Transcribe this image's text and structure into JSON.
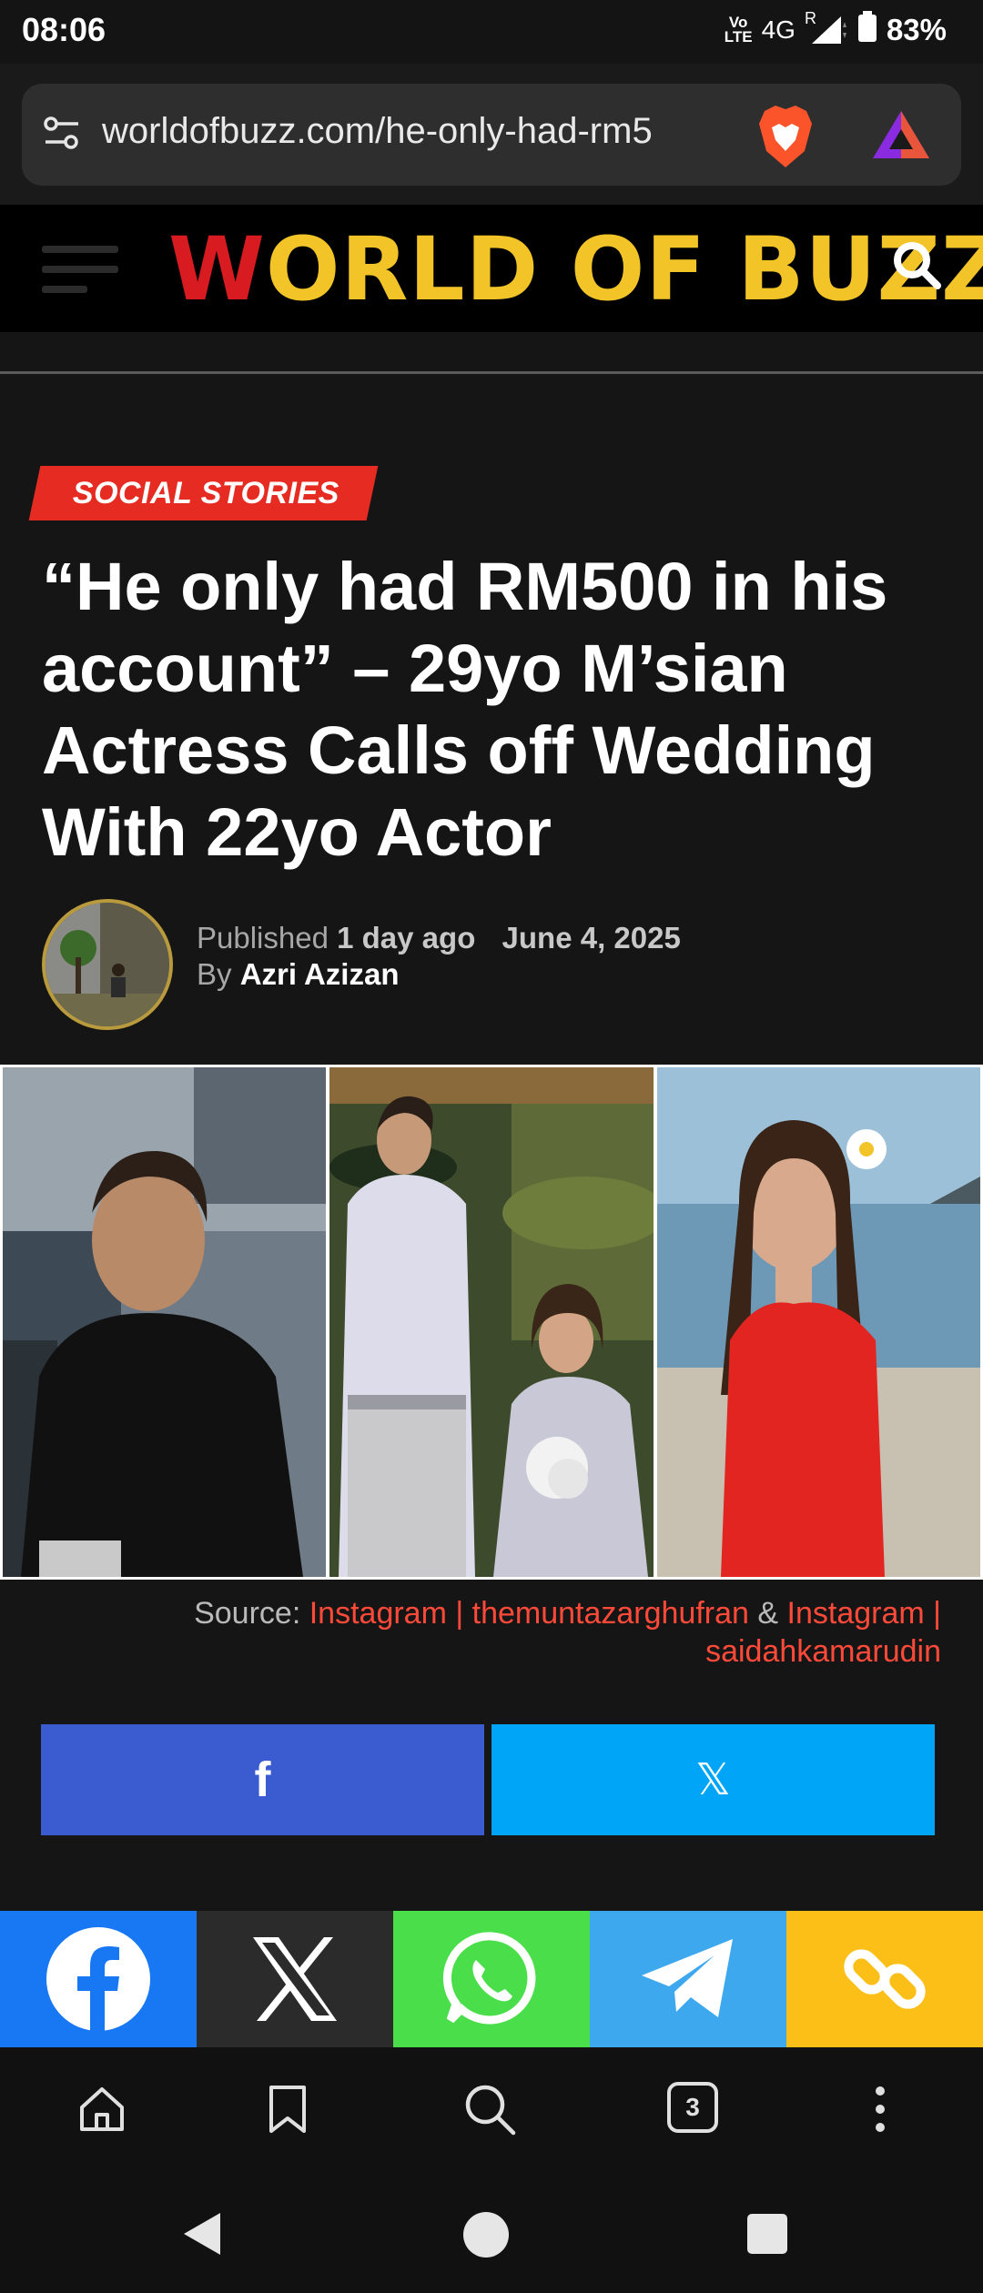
{
  "status_bar": {
    "time": "08:06",
    "network": "4G",
    "roaming": "R",
    "volte_top": "Vo",
    "volte_bottom": "LTE",
    "battery": "83%"
  },
  "browser": {
    "url": "worldofbuzz.com/he-only-had-rm5",
    "tab_count": "3"
  },
  "site": {
    "logo_w": "W",
    "logo_rest": "ORLD OF BUZZ"
  },
  "article": {
    "category": "SOCIAL STORIES",
    "title": "“He only had RM500 in his account” – 29yo M’sian Actress Calls off Wedding With 22yo Actor",
    "published_label": "Published",
    "published_ago": "1 day ago",
    "date": "June 4, 2025",
    "by_label": "By",
    "author": "Azri Azizan",
    "source_label": "Source:",
    "source_link1": "Instagram | themuntazarghufran",
    "source_amp": "&",
    "source_link2": "Instagram | saidahkamarudin"
  },
  "share": {
    "facebook_icon": "f",
    "x_icon": "𝕏"
  },
  "colors": {
    "accent_red": "#e62c22",
    "facebook": "#1877f2",
    "x": "#2b2b2b",
    "whatsapp": "#4ade4a",
    "telegram": "#3da8ee",
    "link": "#fcbf17"
  }
}
